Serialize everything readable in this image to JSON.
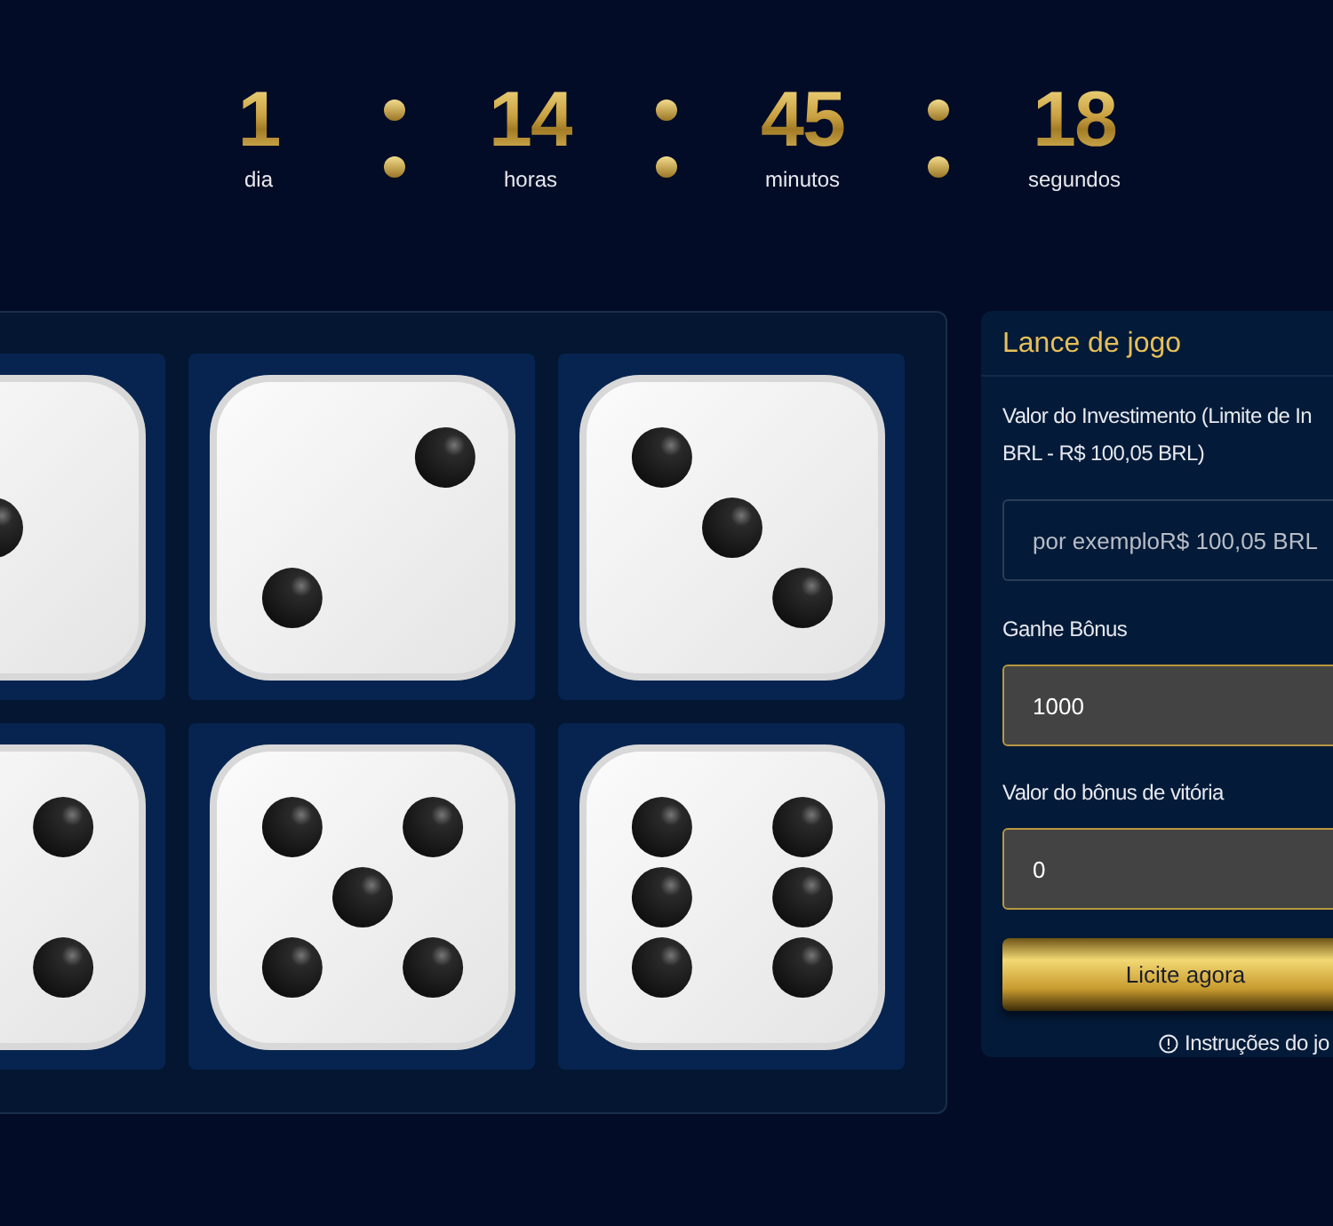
{
  "countdown": [
    {
      "value": "1",
      "unit": "dia"
    },
    {
      "value": "14",
      "unit": "horas"
    },
    {
      "value": "45",
      "unit": "minutos"
    },
    {
      "value": "18",
      "unit": "segundos"
    }
  ],
  "dice": [
    {
      "kind": "one"
    },
    {
      "kind": "two"
    },
    {
      "kind": "three"
    },
    {
      "kind": "four"
    },
    {
      "kind": "five"
    },
    {
      "kind": "six"
    }
  ],
  "bet_panel": {
    "title": "Lance de jogo",
    "investment": {
      "label_lines": [
        "Valor do Investimento (Limite de In",
        "BRL - R$ 100,05 BRL)"
      ],
      "placeholder": "por exemploR$ 100,05 BRL"
    },
    "bonus": {
      "label": "Ganhe Bônus",
      "value": "1000"
    },
    "win_bonus": {
      "label": "Valor do bônus de vitória",
      "value": "0"
    },
    "button": "Licite agora",
    "instructions": "Instruções do jo"
  }
}
